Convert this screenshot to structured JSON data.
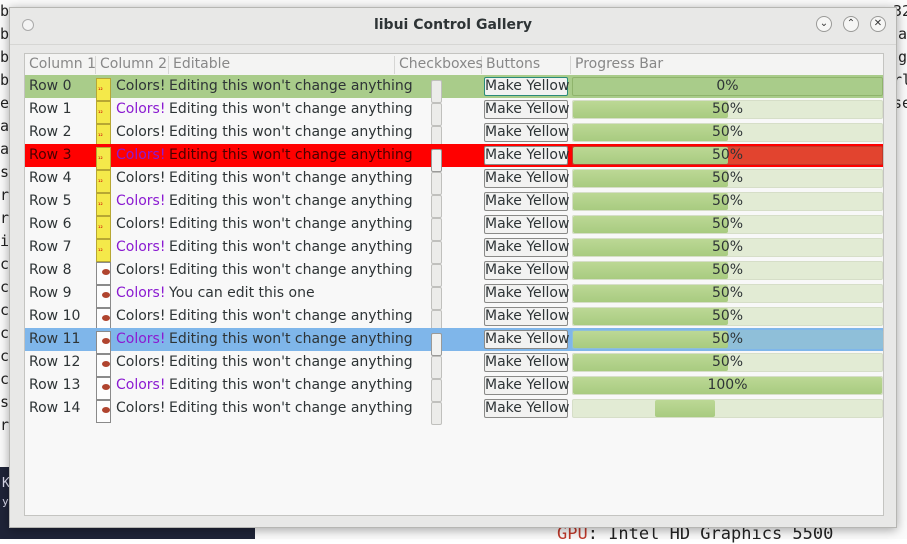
{
  "window": {
    "title": "libui Control Gallery"
  },
  "background": {
    "left_chars": [
      "b",
      "b",
      "b",
      "b",
      "",
      "e",
      "a",
      "a",
      "s",
      "r",
      "r",
      "i",
      "c",
      "c",
      "c",
      "c",
      "c",
      "c",
      "s",
      "r"
    ],
    "right_chars": [
      "32",
      "a",
      "g",
      "",
      "rl",
      "",
      "se",
      "",
      "",
      "",
      "",
      "",
      "",
      "",
      "",
      "",
      "",
      "",
      "",
      ""
    ],
    "gpu_key": "GPU",
    "gpu_value": ": Intel HD Graphics 5500",
    "strip_line1": "K",
    "strip_line2": "ys"
  },
  "columns": [
    "Column 1",
    "Column 2",
    "Editable",
    "Checkboxes",
    "Buttons",
    "Progress Bar"
  ],
  "colors": {
    "row_green": "#a9cc8a",
    "row_red": "#ff0000",
    "row_selected": "#7fb6ea",
    "purple_text": "#8b1bd1",
    "red_progress": "#e2442f",
    "progress_fill": "#a8cb80",
    "progress_track": "#e2ebd4"
  },
  "rows": [
    {
      "name": "Row 0",
      "icon": "yellow",
      "colors": "Colors!",
      "colors_purple": false,
      "editable": "Editing this won't change anything",
      "button": "Make Yellow",
      "progress": "0%",
      "progress_value": 0,
      "bg": "green"
    },
    {
      "name": "Row 1",
      "icon": "yellow",
      "colors": "Colors!",
      "colors_purple": true,
      "editable": "Editing this won't change anything",
      "button": "Make Yellow",
      "progress": "50%",
      "progress_value": 50,
      "bg": "none"
    },
    {
      "name": "Row 2",
      "icon": "yellow",
      "colors": "Colors!",
      "colors_purple": false,
      "editable": "Editing this won't change anything",
      "button": "Make Yellow",
      "progress": "50%",
      "progress_value": 50,
      "bg": "none"
    },
    {
      "name": "Row 3",
      "icon": "yellow",
      "colors": "Colors!",
      "colors_purple": true,
      "editable": "Editing this won't change anything",
      "button": "Make Yellow",
      "progress": "50%",
      "progress_value": 50,
      "bg": "red"
    },
    {
      "name": "Row 4",
      "icon": "yellow",
      "colors": "Colors!",
      "colors_purple": false,
      "editable": "Editing this won't change anything",
      "button": "Make Yellow",
      "progress": "50%",
      "progress_value": 50,
      "bg": "none"
    },
    {
      "name": "Row 5",
      "icon": "yellow",
      "colors": "Colors!",
      "colors_purple": true,
      "editable": "Editing this won't change anything",
      "button": "Make Yellow",
      "progress": "50%",
      "progress_value": 50,
      "bg": "none"
    },
    {
      "name": "Row 6",
      "icon": "yellow",
      "colors": "Colors!",
      "colors_purple": false,
      "editable": "Editing this won't change anything",
      "button": "Make Yellow",
      "progress": "50%",
      "progress_value": 50,
      "bg": "none"
    },
    {
      "name": "Row 7",
      "icon": "yellow",
      "colors": "Colors!",
      "colors_purple": true,
      "editable": "Editing this won't change anything",
      "button": "Make Yellow",
      "progress": "50%",
      "progress_value": 50,
      "bg": "none"
    },
    {
      "name": "Row 8",
      "icon": "gray",
      "colors": "Colors!",
      "colors_purple": false,
      "editable": "Editing this won't change anything",
      "button": "Make Yellow",
      "progress": "50%",
      "progress_value": 50,
      "bg": "none"
    },
    {
      "name": "Row 9",
      "icon": "gray",
      "colors": "Colors!",
      "colors_purple": true,
      "editable": "You can edit this one",
      "button": "Make Yellow",
      "progress": "50%",
      "progress_value": 50,
      "bg": "none"
    },
    {
      "name": "Row 10",
      "icon": "gray",
      "colors": "Colors!",
      "colors_purple": false,
      "editable": "Editing this won't change anything",
      "button": "Make Yellow",
      "progress": "50%",
      "progress_value": 50,
      "bg": "none"
    },
    {
      "name": "Row 11",
      "icon": "gray",
      "colors": "Colors!",
      "colors_purple": true,
      "editable": "Editing this won't change anything",
      "button": "Make Yellow",
      "progress": "50%",
      "progress_value": 50,
      "bg": "selected"
    },
    {
      "name": "Row 12",
      "icon": "gray",
      "colors": "Colors!",
      "colors_purple": false,
      "editable": "Editing this won't change anything",
      "button": "Make Yellow",
      "progress": "50%",
      "progress_value": 50,
      "bg": "none"
    },
    {
      "name": "Row 13",
      "icon": "gray",
      "colors": "Colors!",
      "colors_purple": true,
      "editable": "Editing this won't change anything",
      "button": "Make Yellow",
      "progress": "100%",
      "progress_value": 100,
      "bg": "none"
    },
    {
      "name": "Row 14",
      "icon": "gray",
      "colors": "Colors!",
      "colors_purple": false,
      "editable": "Editing this won't change anything",
      "button": "Make Yellow",
      "progress": "",
      "progress_value": null,
      "bg": "none",
      "indeterminate": true
    }
  ]
}
